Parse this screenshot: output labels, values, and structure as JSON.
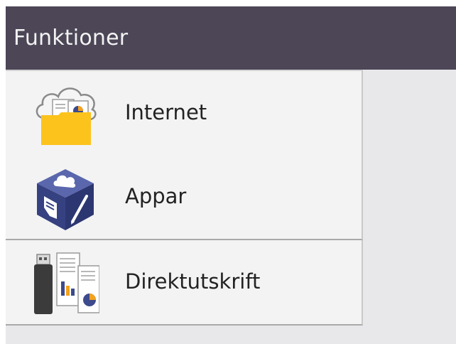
{
  "header": {
    "title": "Funktioner"
  },
  "menu": {
    "items": [
      {
        "label": "Internet",
        "icon": "cloud-folder-icon"
      },
      {
        "label": "Appar",
        "icon": "apps-cube-icon"
      },
      {
        "label": "Direktutskrift",
        "icon": "usb-documents-icon"
      }
    ]
  },
  "colors": {
    "header_background": "#4c4657",
    "header_text": "#f2f2f2",
    "item_background": "#f3f3f3",
    "screen_background": "#e8e8eb",
    "folder_yellow": "#fcc31d",
    "cube_blue": "#3f4a90"
  }
}
